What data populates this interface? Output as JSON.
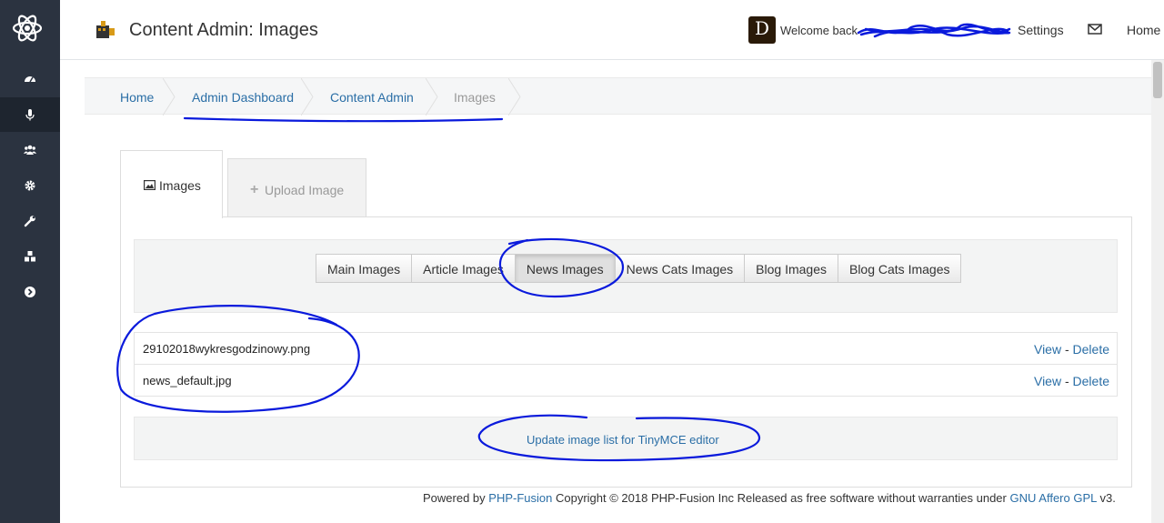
{
  "header": {
    "title": "Content Admin: Images",
    "avatar_letter": "D",
    "welcome": "Welcome back",
    "settings": "Settings",
    "home": "Home"
  },
  "breadcrumb": {
    "items": [
      "Home",
      "Admin Dashboard",
      "Content Admin",
      "Images"
    ]
  },
  "tabs": {
    "images": "Images",
    "upload": "Upload Image"
  },
  "folders": [
    "Main Images",
    "Article Images",
    "News Images",
    "News Cats Images",
    "Blog Images",
    "Blog Cats Images"
  ],
  "active_folder": "News Images",
  "files": [
    {
      "name": "29102018wykresgodzinowy.png",
      "view": "View",
      "delete": "Delete"
    },
    {
      "name": "news_default.jpg",
      "view": "View",
      "delete": "Delete"
    }
  ],
  "update_link": "Update image list for TinyMCE editor",
  "footer": {
    "powered_by": "Powered by",
    "php_fusion": "PHP-Fusion",
    "copyright": "Copyright © 2018 PHP-Fusion Inc Released as free software without warranties under",
    "license": "GNU Affero GPL",
    "version": "v3."
  },
  "colors": {
    "sidebar": "#2b3340",
    "link": "#2a6ea6",
    "ink": "#0a1adc"
  },
  "sidebar_icons": [
    "atom-logo-icon",
    "dashboard-icon",
    "microphone-icon",
    "users-icon",
    "gear-icon",
    "wrench-icon",
    "cubes-icon",
    "chevron-circle-right-icon"
  ]
}
